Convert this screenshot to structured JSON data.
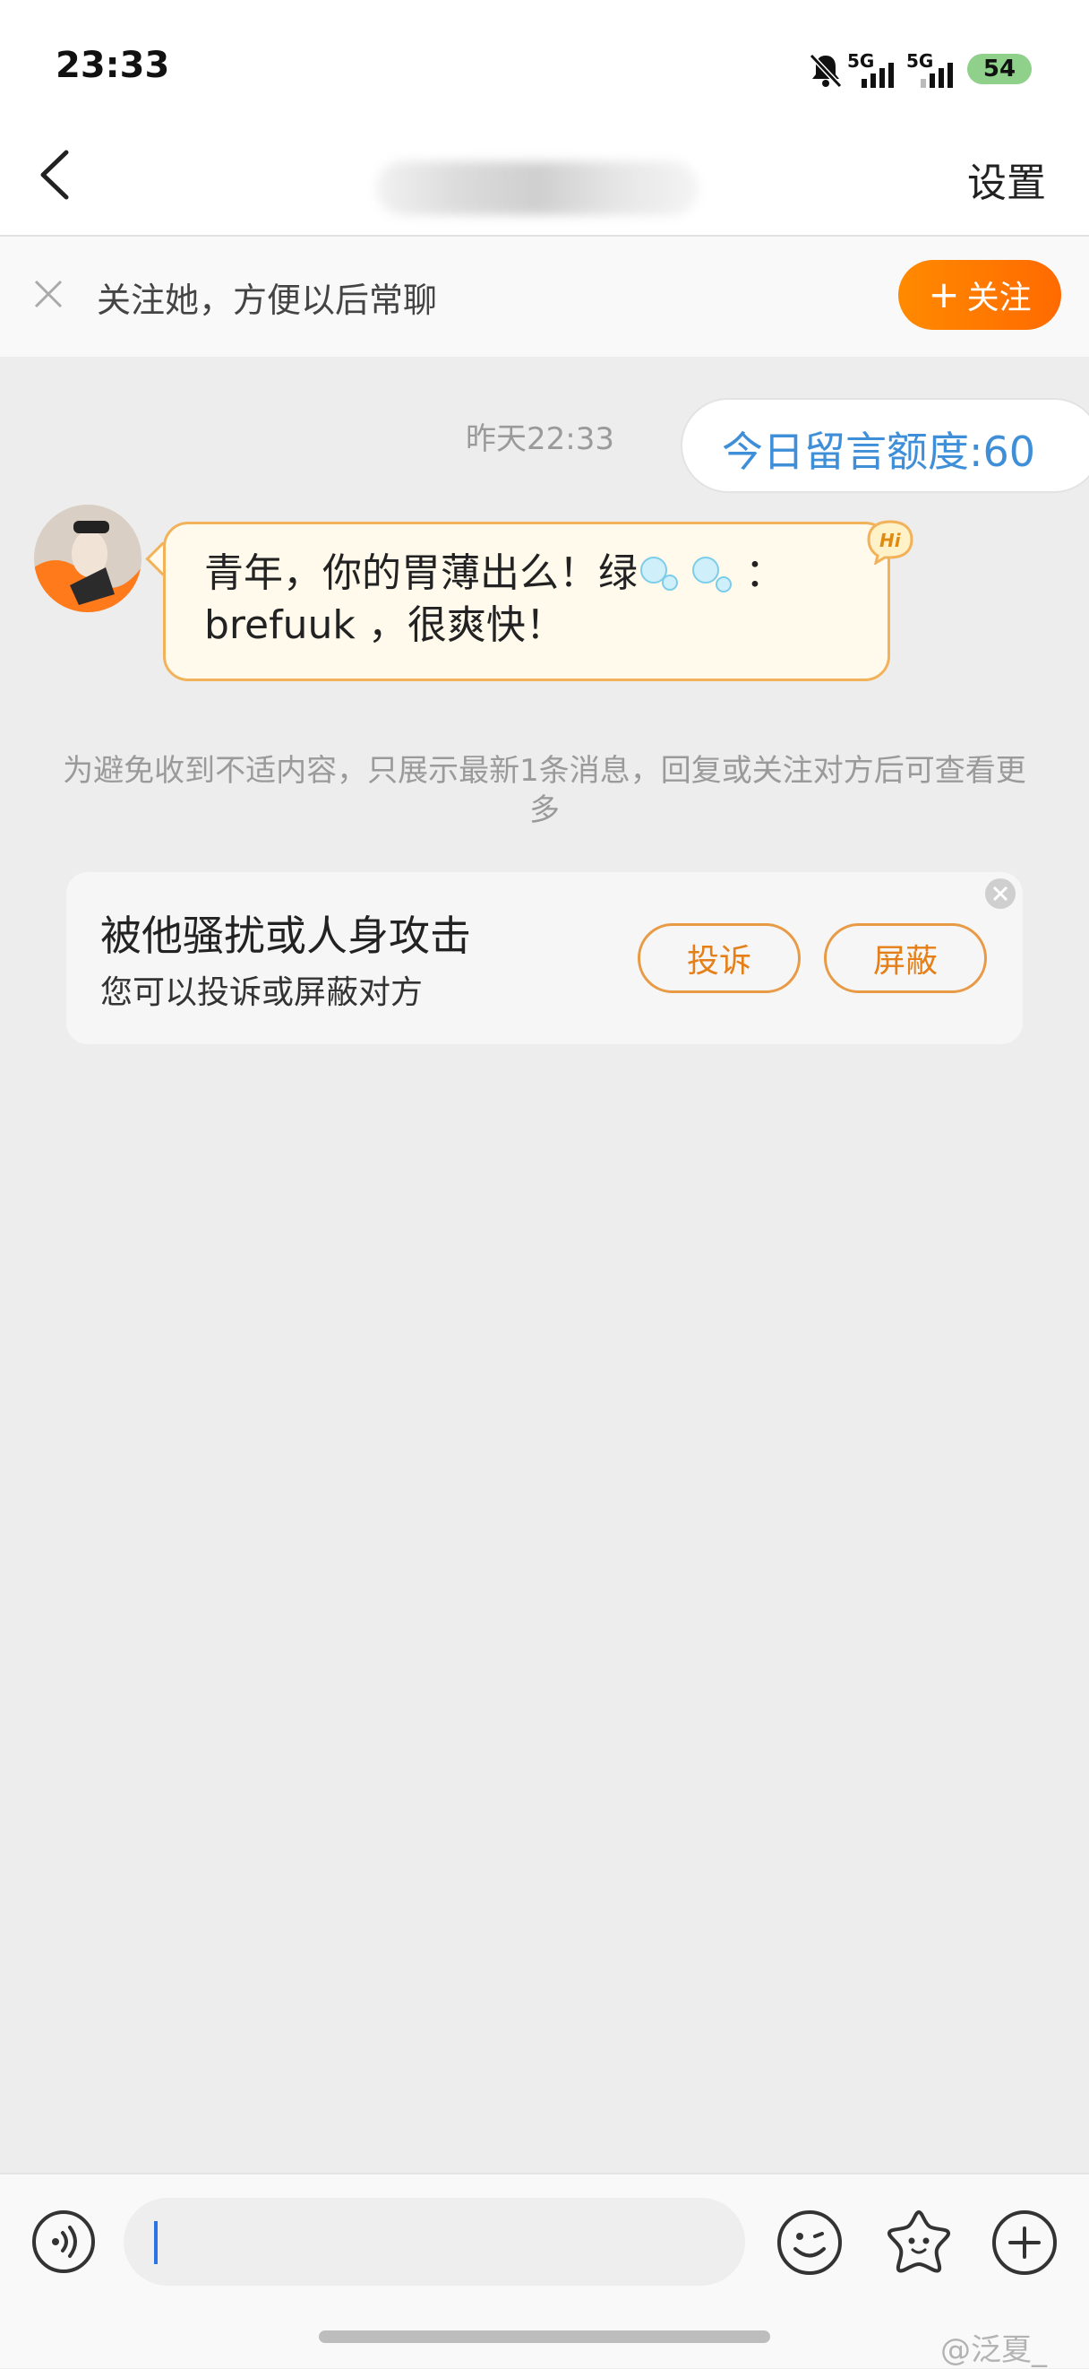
{
  "status_bar": {
    "time": "23:33",
    "net1": "5G",
    "net2": "5G",
    "battery": "54",
    "icons": [
      "bell-muted-icon",
      "signal-icon",
      "signal-icon",
      "battery-icon"
    ]
  },
  "nav": {
    "settings_label": "设置",
    "icons": [
      "back-icon"
    ]
  },
  "follow_bar": {
    "text": "关注她，方便以后常聊",
    "button_plus": "+",
    "button_label": "关注",
    "icons": [
      "close-icon"
    ]
  },
  "chat": {
    "timestamp": "昨天22:33",
    "quota_text": "今日留言额度:60",
    "message_line1": "青年，你的胃薄出么！绿",
    "message_line1_tail": "：",
    "message_line2": "brefuuk ，很爽快！",
    "hi_badge": "Hi",
    "notice": "为避免收到不适内容，只展示最新1条消息，回复或关注对方后可查看更多"
  },
  "harassment_card": {
    "title": "被他骚扰或人身攻击",
    "subtitle": "您可以投诉或屏蔽对方",
    "report_label": "投诉",
    "block_label": "屏蔽"
  },
  "input_bar": {
    "placeholder": "",
    "icons": [
      "voice-icon",
      "emoji-icon",
      "star-icon",
      "plus-icon"
    ]
  },
  "watermark": "@泛夏_",
  "colors": {
    "accent_orange": "#ff7a00",
    "quota_blue": "#3f8fd8",
    "bubble_fill": "#fffaec",
    "bubble_border": "#f1b25a",
    "battery_green": "#8fd08b"
  }
}
